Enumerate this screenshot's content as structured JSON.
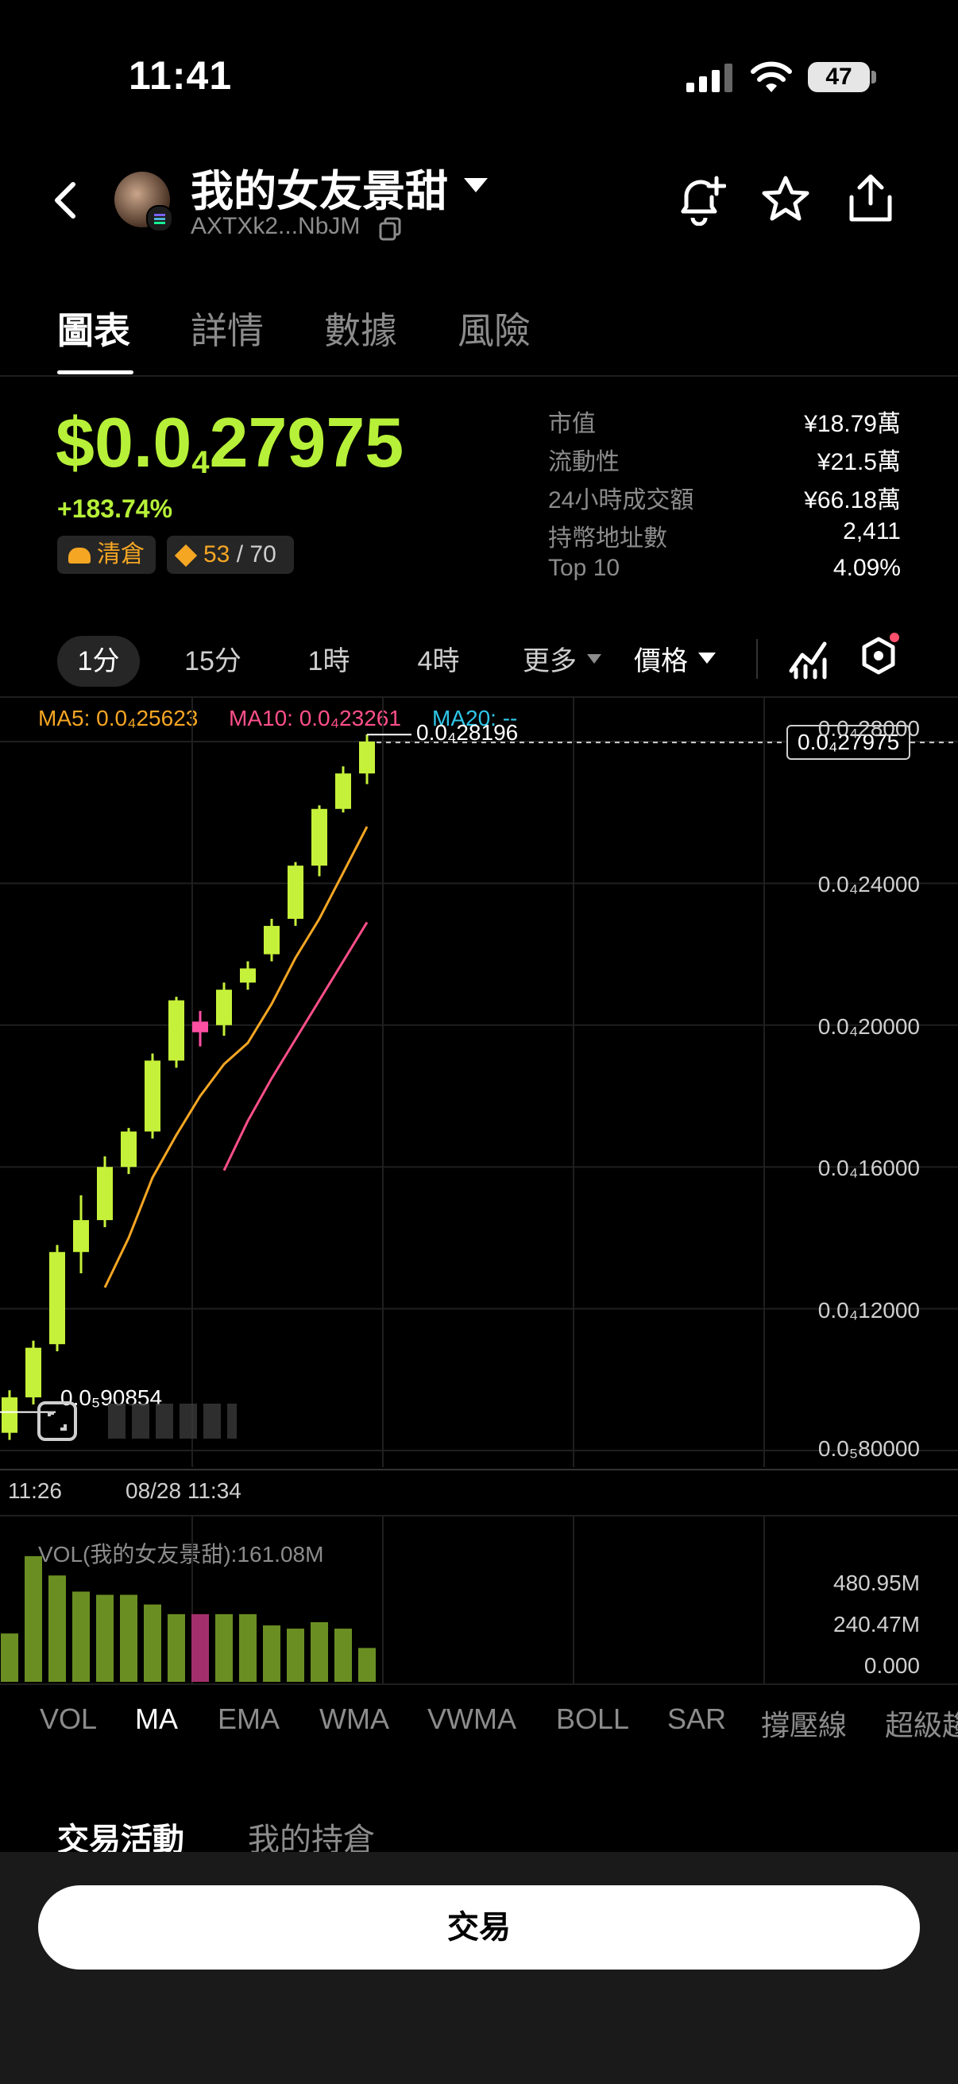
{
  "status_bar": {
    "time": "11:41",
    "battery": "47"
  },
  "header": {
    "title": "我的女友景甜",
    "address": "AXTXk2...NbJM"
  },
  "tabs": [
    "圖表",
    "詳情",
    "數據",
    "風險"
  ],
  "price": {
    "prefix": "$0.0",
    "zeros": "4",
    "digits": "27975",
    "change": "+183.74%",
    "badge_label": "清倉",
    "score": "53",
    "score_total": "/ 70"
  },
  "stats": [
    {
      "label": "市值",
      "value": "¥18.79萬"
    },
    {
      "label": "流動性",
      "value": "¥21.5萬"
    },
    {
      "label": "24小時成交額",
      "value": "¥66.18萬"
    },
    {
      "label": "持幣地址數",
      "value": "2,411"
    },
    {
      "label": "Top 10",
      "value": "4.09%"
    }
  ],
  "timeframes": [
    "1分",
    "15分",
    "1時",
    "4時",
    "更多"
  ],
  "price_toggle": "價格",
  "ma_legend": {
    "ma5": "MA5: 0.0₄25623",
    "ma10": "MA10: 0.0₄23261",
    "ma20": "MA20: --"
  },
  "colors": {
    "up": "#c6f13a",
    "down": "#ff4fa3",
    "ma5": "#f5a623",
    "ma10": "#ff4f8b",
    "ma20": "#2fc6e8"
  },
  "chart_data": {
    "type": "candlestick",
    "y_ticks": [
      "0.0₄28000",
      "0.0₄24000",
      "0.0₄20000",
      "0.0₄16000",
      "0.0₄12000",
      "0.0₅80000"
    ],
    "y_values": [
      2.8,
      2.4,
      2.0,
      1.6,
      1.2,
      0.8
    ],
    "ylim": [
      0.78,
      2.84
    ],
    "x_labels": [
      "11:26",
      "08/28 11:34"
    ],
    "current_price_label": "0.0₄27975",
    "current_price": 2.7975,
    "high_label": "0.0₄28196",
    "high_value": 2.8196,
    "low_label": "0.0₅90854",
    "low_value": 0.90854,
    "candles": [
      {
        "o": 0.85,
        "c": 0.95,
        "h": 0.97,
        "l": 0.83
      },
      {
        "o": 0.95,
        "c": 1.09,
        "h": 1.11,
        "l": 0.93
      },
      {
        "o": 1.1,
        "c": 1.36,
        "h": 1.38,
        "l": 1.08
      },
      {
        "o": 1.36,
        "c": 1.45,
        "h": 1.52,
        "l": 1.3
      },
      {
        "o": 1.45,
        "c": 1.6,
        "h": 1.63,
        "l": 1.43
      },
      {
        "o": 1.6,
        "c": 1.7,
        "h": 1.71,
        "l": 1.58
      },
      {
        "o": 1.7,
        "c": 1.9,
        "h": 1.92,
        "l": 1.68
      },
      {
        "o": 1.9,
        "c": 2.07,
        "h": 2.08,
        "l": 1.88
      },
      {
        "o": 2.01,
        "c": 1.98,
        "h": 2.04,
        "l": 1.94
      },
      {
        "o": 2.0,
        "c": 2.1,
        "h": 2.12,
        "l": 1.97
      },
      {
        "o": 2.12,
        "c": 2.16,
        "h": 2.18,
        "l": 2.1
      },
      {
        "o": 2.2,
        "c": 2.28,
        "h": 2.3,
        "l": 2.18
      },
      {
        "o": 2.3,
        "c": 2.45,
        "h": 2.46,
        "l": 2.28
      },
      {
        "o": 2.45,
        "c": 2.61,
        "h": 2.62,
        "l": 2.42
      },
      {
        "o": 2.61,
        "c": 2.71,
        "h": 2.73,
        "l": 2.6
      },
      {
        "o": 2.71,
        "c": 2.8,
        "h": 2.82,
        "l": 2.68
      }
    ],
    "ma5": [
      null,
      null,
      null,
      null,
      1.26,
      1.4,
      1.57,
      1.69,
      1.8,
      1.89,
      1.95,
      2.06,
      2.19,
      2.3,
      2.43,
      2.56
    ],
    "ma10": [
      null,
      null,
      null,
      null,
      null,
      null,
      null,
      null,
      null,
      1.59,
      1.73,
      1.85,
      1.96,
      2.07,
      2.18,
      2.29
    ]
  },
  "volume": {
    "label": "VOL(我的女友景甜):161.08M",
    "ticks": [
      "480.95M",
      "240.47M",
      "0.000"
    ],
    "max": 480.95,
    "values": [
      150,
      390,
      330,
      280,
      270,
      270,
      240,
      210,
      210,
      210,
      210,
      175,
      165,
      185,
      165,
      105
    ],
    "down_index": 8
  },
  "indicators": [
    "VOL",
    "MA",
    "EMA",
    "WMA",
    "VWMA",
    "BOLL",
    "SAR",
    "撐壓線",
    "超級趨"
  ],
  "section_tabs": [
    "交易活動",
    "我的持倉"
  ],
  "trade_button": "交易"
}
